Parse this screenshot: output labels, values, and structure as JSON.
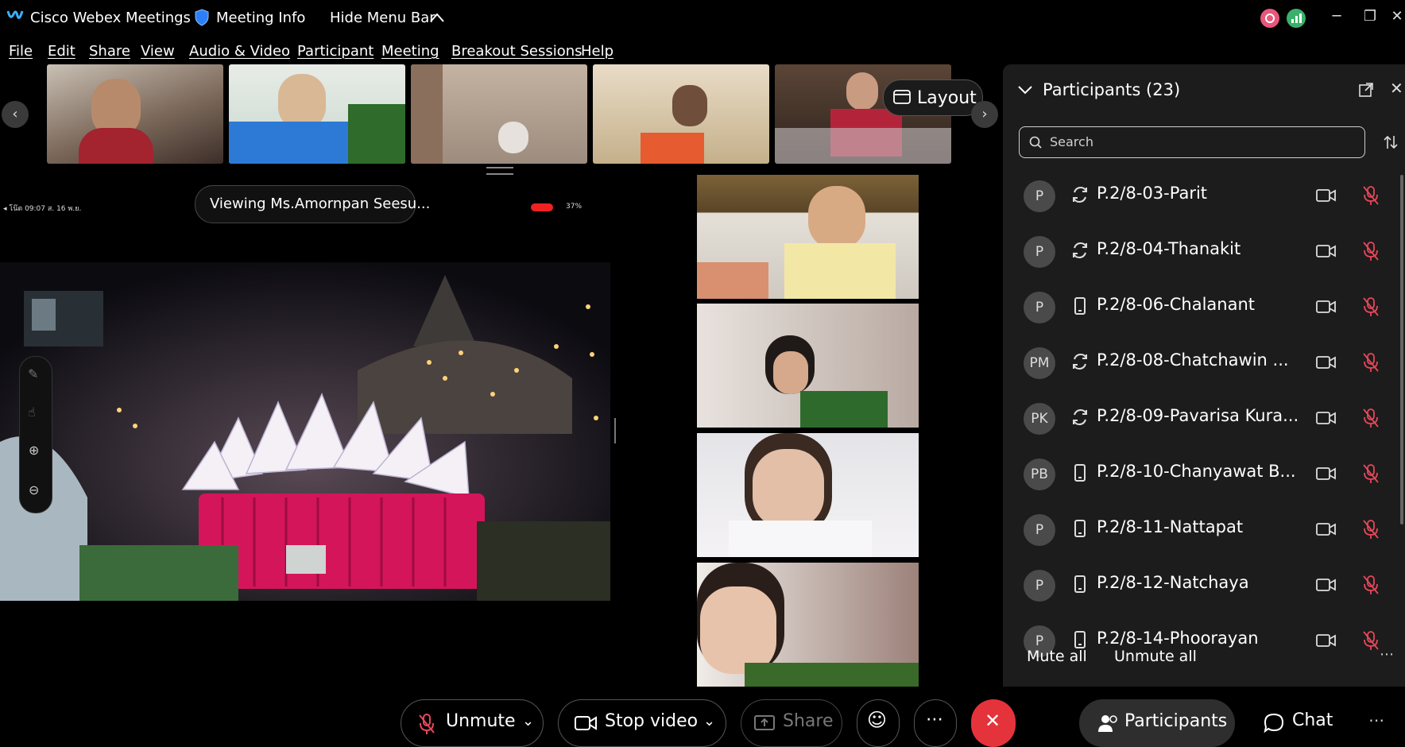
{
  "window": {
    "app_title": "Cisco Webex Meetings",
    "meeting_info": "Meeting Info",
    "hide_menu": "Hide Menu Bar",
    "minimize_icon": "minimize-icon",
    "restore_icon": "restore-icon",
    "close_icon": "close-icon"
  },
  "menu": [
    "File",
    "Edit",
    "Share",
    "View",
    "Audio & Video",
    "Participant",
    "Meeting",
    "Breakout Sessions",
    "Help"
  ],
  "filmstrip": {
    "layout_label": "Layout",
    "thumb_colors": [
      "#8a7b6e",
      "#3b5f8f",
      "#b8a48f",
      "#c2b08c",
      "#5a4638"
    ]
  },
  "share": {
    "viewing_label": "Viewing Ms.Amornpan Seesu...",
    "status_left": "◂ โน๊ต  09:07  ส. 16 พ.ย.",
    "status_right": "37%"
  },
  "participants_panel": {
    "title": "Participants (23)",
    "search_placeholder": "Search",
    "mute_all": "Mute all",
    "unmute_all": "Unmute all",
    "rows": [
      {
        "initials": "P",
        "name": "P.2/8-03-Parit",
        "device": "sync-icon"
      },
      {
        "initials": "P",
        "name": "P.2/8-04-Thanakit",
        "device": "sync-icon"
      },
      {
        "initials": "P",
        "name": "P.2/8-06-Chalanant",
        "device": "mobile-icon"
      },
      {
        "initials": "PM",
        "name": "P.2/8-08-Chatchawin ...",
        "device": "sync-icon"
      },
      {
        "initials": "PK",
        "name": "P.2/8-09-Pavarisa Kura...",
        "device": "sync-icon"
      },
      {
        "initials": "PB",
        "name": "P.2/8-10-Chanyawat B...",
        "device": "mobile-icon"
      },
      {
        "initials": "P",
        "name": "P.2/8-11-Nattapat",
        "device": "mobile-icon"
      },
      {
        "initials": "P",
        "name": "P.2/8-12-Natchaya",
        "device": "mobile-icon"
      },
      {
        "initials": "P",
        "name": "P.2/8-14-Phoorayan",
        "device": "mobile-icon"
      }
    ]
  },
  "controls": {
    "unmute": "Unmute",
    "stop_video": "Stop video",
    "share": "Share",
    "participants": "Participants",
    "chat": "Chat",
    "end_color": "#e5333b"
  },
  "tiles": {
    "colors": [
      "#6f5a3e",
      "#b49c8c",
      "#d9d4d6",
      "#8f7a74"
    ]
  }
}
